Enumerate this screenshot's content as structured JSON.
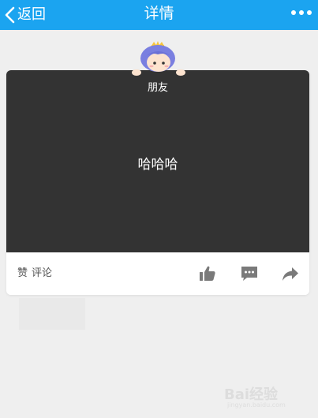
{
  "navbar": {
    "back_label": "返回",
    "title": "详情",
    "background": "#1ba4f0"
  },
  "post": {
    "sender": "朋友",
    "message": "哈哈哈",
    "card_background": "#333333"
  },
  "actions": {
    "like_label": "赞",
    "comment_label": "评论",
    "icons": [
      "thumbs-up-icon",
      "comment-icon",
      "share-icon"
    ]
  },
  "watermark": {
    "text": "Bai经验",
    "url": "jingyan.baidu.com"
  }
}
